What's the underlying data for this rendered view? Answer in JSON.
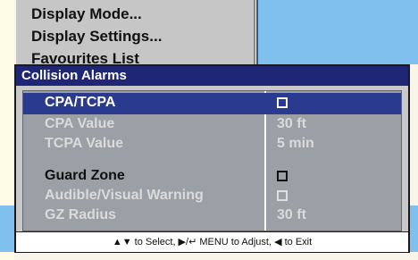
{
  "background_menu": {
    "items": [
      "Display Mode...",
      "Display Settings...",
      "Favourites List"
    ]
  },
  "dialog": {
    "title": "Collision Alarms",
    "rows": [
      {
        "label": "CPA/TCPA",
        "value": "",
        "checkbox": true,
        "state": "selected"
      },
      {
        "label": "CPA Value",
        "value": "30 ft",
        "checkbox": false,
        "state": "disabled"
      },
      {
        "label": "TCPA Value",
        "value": "5 min",
        "checkbox": false,
        "state": "disabled"
      },
      {
        "label": "Guard Zone",
        "value": "",
        "checkbox": true,
        "state": "active"
      },
      {
        "label": "Audible/Visual Warning",
        "value": "",
        "checkbox": true,
        "state": "disabled"
      },
      {
        "label": "GZ Radius",
        "value": "30 ft",
        "checkbox": false,
        "state": "disabled"
      }
    ],
    "footer": "▲▼ to Select, ▶/↵ MENU to Adjust, ◀ to Exit"
  },
  "colors": {
    "title_bar": "#1e2675",
    "selected_row": "#2a3a8e",
    "dialog_bg": "#c9c9c9",
    "table_bg": "#9aa0a6"
  }
}
